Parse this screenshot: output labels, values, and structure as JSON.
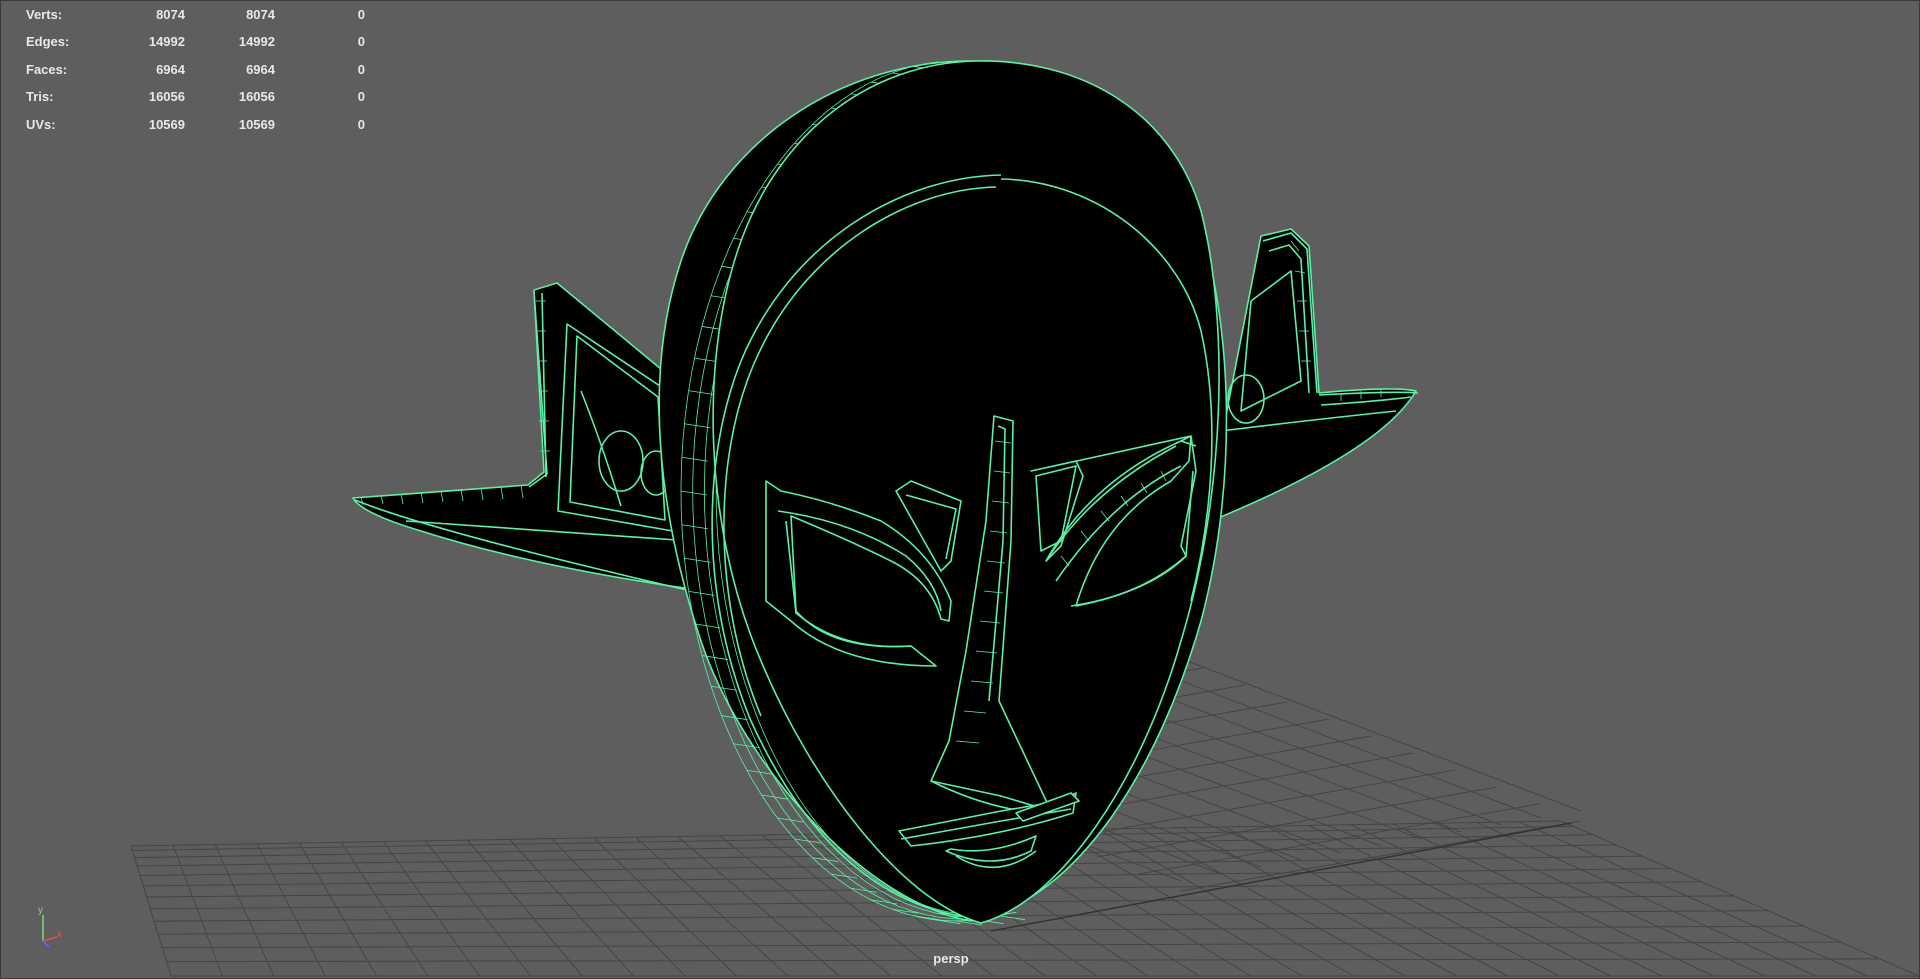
{
  "viewport": {
    "camera": "persp",
    "wireframe_color": "#5cf0a4",
    "background_color": "#5e5e5e"
  },
  "hud": {
    "stats": [
      {
        "label": "Verts:",
        "v1": "8074",
        "v2": "8074",
        "v3": "0"
      },
      {
        "label": "Edges:",
        "v1": "14992",
        "v2": "14992",
        "v3": "0"
      },
      {
        "label": "Faces:",
        "v1": "6964",
        "v2": "6964",
        "v3": "0"
      },
      {
        "label": "Tris:",
        "v1": "16056",
        "v2": "16056",
        "v3": "0"
      },
      {
        "label": "UVs:",
        "v1": "10569",
        "v2": "10569",
        "v3": "0"
      }
    ]
  },
  "axis_gizmo": {
    "y_label": "y",
    "x_label": "x",
    "y_color": "#7cd97c",
    "x_color": "#e05050",
    "z_color": "#5a6cff"
  }
}
